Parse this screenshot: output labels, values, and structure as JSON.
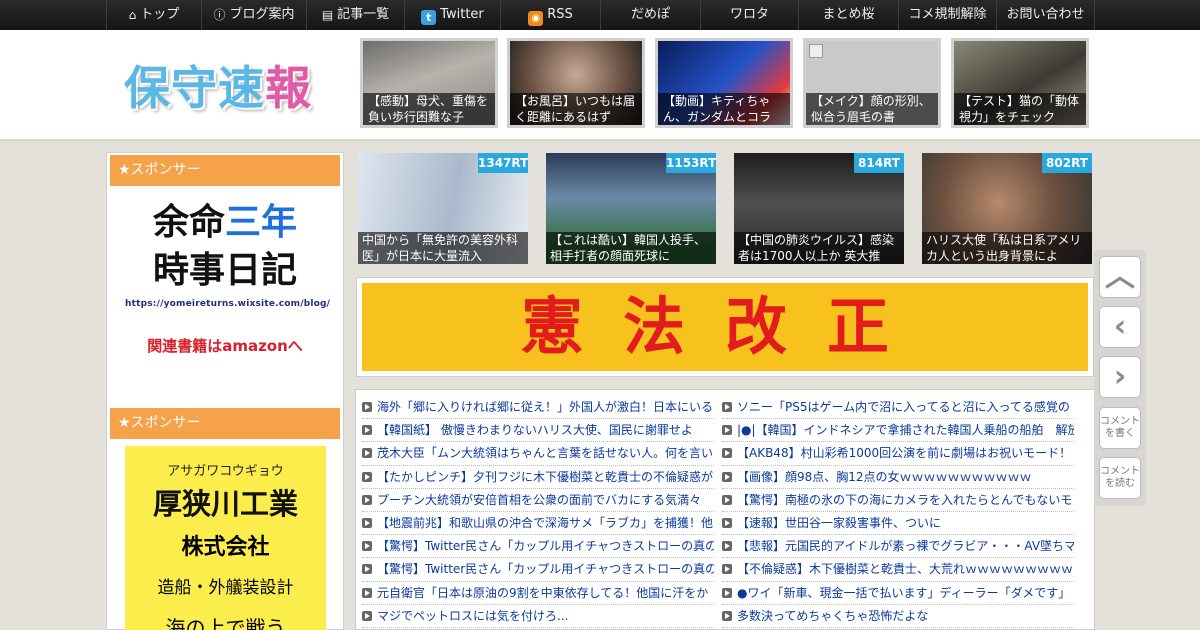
{
  "nav": [
    {
      "icon": "home-icon",
      "glyph": "⌂",
      "label": "トップ"
    },
    {
      "icon": "info-icon",
      "glyph": "ⓘ",
      "label": "ブログ案内"
    },
    {
      "icon": "list-icon",
      "glyph": "▤",
      "label": "記事一覧"
    },
    {
      "icon": "twitter-icon",
      "glyph": "t",
      "label": "Twitter"
    },
    {
      "icon": "rss-icon",
      "glyph": "◉",
      "label": "RSS"
    },
    {
      "label": "だめぽ"
    },
    {
      "label": "ワロタ"
    },
    {
      "label": "まとめ桜"
    },
    {
      "label": "コメ規制解除"
    },
    {
      "label": "お問い合わせ"
    }
  ],
  "logo": {
    "part1": "保守",
    "part2": "速",
    "part3": "報"
  },
  "header_thumbs": [
    {
      "caption": "【感動】母犬、重傷を負い歩行困難な子"
    },
    {
      "caption": "【お風呂】いつもは届く距離にあるはず"
    },
    {
      "caption": "【動画】キティちゃん、ガンダムとコラ"
    },
    {
      "caption": "【メイク】顔の形別、似合う眉毛の書"
    },
    {
      "caption": "【テスト】猫の「動体視力」をチェック"
    }
  ],
  "sidebar": {
    "sponsor1_heading": "★スポンサー",
    "ad1": {
      "line1a": "余命",
      "line1b": "三年",
      "line2": "時事日記",
      "url": "https://yomeireturns.wixsite.com/blog/",
      "amazon": "関連書籍はamazonへ"
    },
    "sponsor2_heading": "★スポンサー",
    "ad2": {
      "kana": "アサガワコウギョウ",
      "name": "厚狭川工業",
      "kk": "株式会社",
      "biz": "造船・外艤装設計",
      "last": "海の上で戦う"
    }
  },
  "rt_items": [
    {
      "rt": "1347RT",
      "caption": "中国から「無免許の美容外科医」が日本に大量流入"
    },
    {
      "rt": "1153RT",
      "caption": "【これは酷い】韓国人投手、相手打者の顔面死球に"
    },
    {
      "rt": "814RT",
      "caption": "【中国の肺炎ウイルス】感染者は1700人以上か 英大推"
    },
    {
      "rt": "802RT",
      "caption": "ハリス大使「私は日系アメリカ人という出身背景によ"
    }
  ],
  "banner": {
    "text": "憲法改正"
  },
  "links_left": [
    "海外「郷に入りければ郷に従え！」外国人が激白！日本にいる",
    "【韓国紙】 傲慢きわまりないハリス大使、国民に謝罪せよ",
    "茂木大臣「ムン大統領はちゃんと言葉を話せない人。何を言い",
    "【たかしピンチ】夕刊フジに木下優樹菜と乾貴士の不倫疑惑が",
    "プーチン大統領が安倍首相を公衆の面前でバカにする気満々",
    "【地震前兆】和歌山県の沖合で深海サメ「ラブカ」を捕獲！他",
    "【驚愕】Twitter民さん「カップル用イチャつきストローの真の",
    "【驚愕】Twitter民さん「カップル用イチャつきストローの真の",
    "元自衛官「日本は原油の9割を中東依存してる！他国に汗をか",
    "マジでペットロスには気を付けろ..."
  ],
  "links_right": [
    "ソニー「PS5はゲーム内で沼に入ってると沼に入ってる感覚の",
    "|●|【韓国】インドネシアで拿捕された韓国人乗船の船舶　解放",
    "【AKB48】村山彩希1000回公演を前に劇場はお祝いモード！",
    "【画像】顔98点、胸12点の女ｗｗｗｗｗｗｗｗｗｗｗ",
    "【驚愕】南極の氷の下の海にカメラを入れたらとんでもないモ",
    "【速報】世田谷一家殺害事件、ついに",
    "【悲報】元国民的アイドルが素っ裸でグラビア・・・AV墜ちマ",
    "【不倫疑惑】木下優樹菜と乾貴士、大荒れｗｗｗｗｗｗｗｗｗ",
    "●ワイ「新車、現金一括で払います」ディーラー「ダメです」",
    "多数決ってめちゃくちゃ恐怖だよな"
  ],
  "sidebuttons": {
    "write": "コメントを書く",
    "read": "コメントを読む"
  }
}
